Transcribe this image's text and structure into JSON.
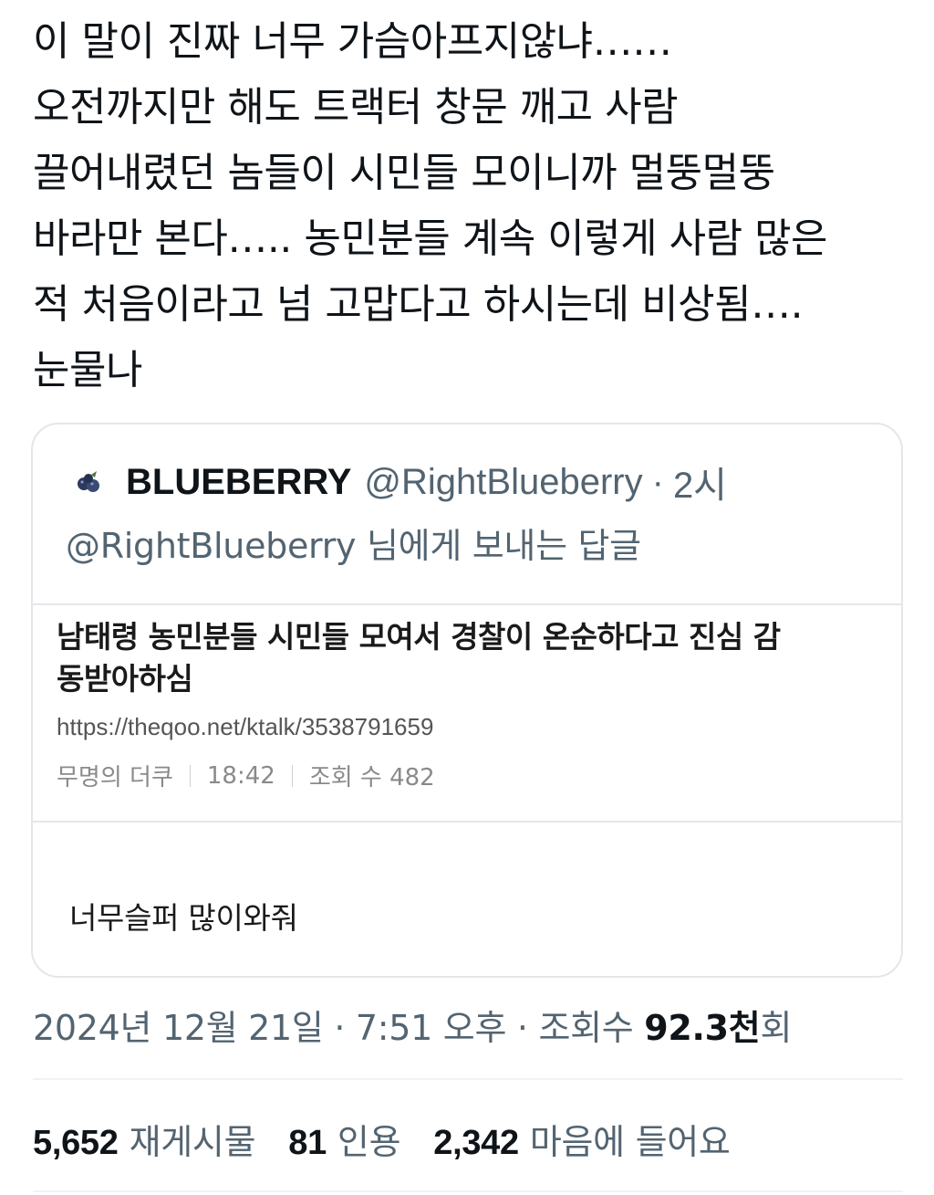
{
  "tweet": {
    "text_lines": [
      "이 말이 진짜 너무 가슴아프지않냐……",
      "오전까지만 해도 트랙터 창문 깨고 사람",
      "끌어내렸던 놈들이 시민들 모이니까 멀뚱멀뚱",
      "바라만 본다….. 농민분들 계속 이렇게 사람 많은",
      "적 처음이라고 넘 고맙다고 하시는데 비상됨….",
      "눈물나"
    ]
  },
  "quote": {
    "avatar_icon": "blueberry-icon",
    "name": "BLUEBERRY",
    "handle": "@RightBlueberry",
    "dot": "·",
    "time": "2시",
    "reply_to": "@RightBlueberry 님에게 보내는 답글",
    "embed": {
      "title_lines": [
        "남태령 농민분들 시민들 모여서 경찰이 온순하다고 진심 감",
        "동받아하심"
      ],
      "url": "https://theqoo.net/ktalk/3538791659",
      "author": "무명의 더쿠",
      "time": "18:42",
      "views": "조회 수 482"
    },
    "body": "너무슬퍼 많이와줘"
  },
  "meta": {
    "timestamp": "2024년 12월 21일 · 7:51 오후 · 조회수",
    "views_num": "92.3천",
    "views_suffix": "회"
  },
  "stats": {
    "retweets_num": "5,652",
    "retweets_label": "재게시물",
    "quotes_num": "81",
    "quotes_label": "인용",
    "likes_num": "2,342",
    "likes_label": "마음에 들어요"
  },
  "colors": {
    "text": "#0f1419",
    "secondary": "#536471",
    "border": "#e3e7ea"
  }
}
